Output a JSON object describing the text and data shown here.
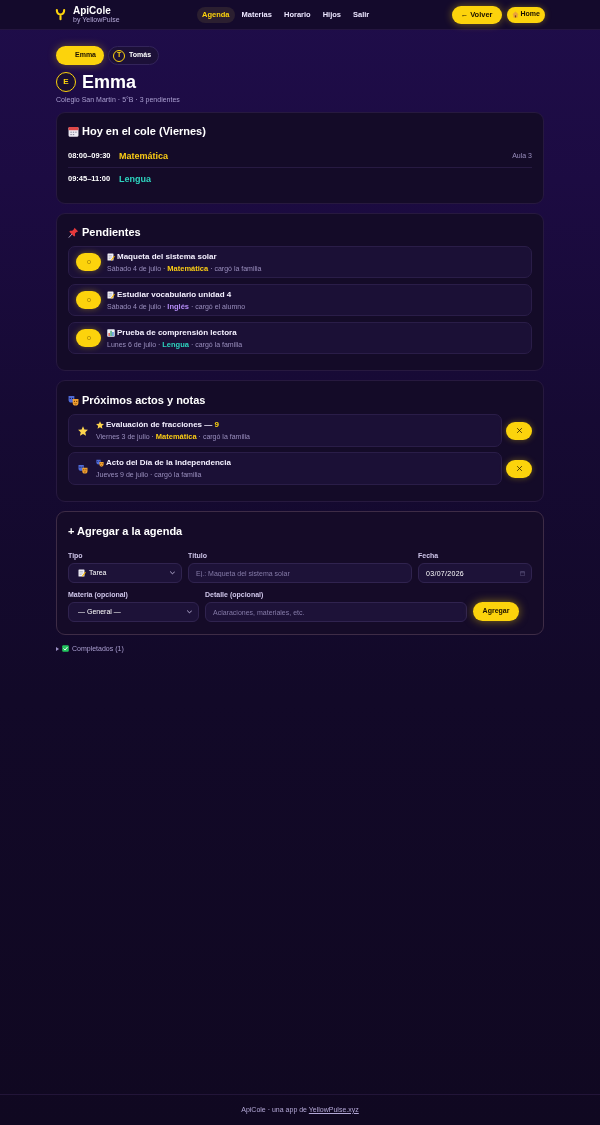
{
  "app": {
    "name": "ApiCole",
    "tagline": "by YellowPulse"
  },
  "nav": [
    {
      "label": "Agenda",
      "selected": true
    },
    {
      "label": "Materias",
      "selected": false
    },
    {
      "label": "Horario",
      "selected": false
    },
    {
      "label": "Hijos",
      "selected": false
    },
    {
      "label": "Salir",
      "selected": false
    }
  ],
  "header_buttons": [
    {
      "kind": "back",
      "label": "← Volver"
    },
    {
      "kind": "home",
      "label": "Home"
    }
  ],
  "children_tabs": [
    {
      "label": "Emma",
      "selected": true
    },
    {
      "label": "Tomás",
      "initial": "T",
      "selected": false
    }
  ],
  "profile": {
    "initial": "E",
    "name": "Emma",
    "subtitle": "Colegio San Martín · 5°B · 3 pendientes"
  },
  "today": {
    "title": "Hoy en el cole (Viernes)",
    "rows": [
      {
        "time": "08:00–09:30",
        "subject": "Matemática",
        "color": "#facc15",
        "room": "Aula 3"
      },
      {
        "time": "09:45–11:00",
        "subject": "Lengua",
        "color": "#2dd4bf"
      }
    ]
  },
  "pending": {
    "title": "Pendientes",
    "items": [
      {
        "kind": "tarea",
        "done": false,
        "title": "Maqueta del sistema solar",
        "date": "Sábado 4 de julio ·",
        "subject": "Matemática",
        "color": "#facc15",
        "source": "· cargó la familia"
      },
      {
        "kind": "tarea",
        "done": false,
        "title": "Estudiar vocabulario unidad 4",
        "date": "Sábado 4 de julio ·",
        "subject": "Inglés",
        "color": "#b48cf5",
        "source": "· cargó el alumno"
      },
      {
        "kind": "prueba",
        "done": false,
        "title": "Prueba de comprensión lectora",
        "date": "Lunes 6 de julio ·",
        "subject": "Lengua",
        "color": "#2dd4bf",
        "source": "· cargó la familia"
      }
    ]
  },
  "upcoming": {
    "title": "Próximos actos y notas",
    "items": [
      {
        "kind": "nota",
        "title": "Evaluación de fracciones —",
        "grade": "9",
        "date": "Viernes 3 de julio ·",
        "subject": "Matemática",
        "color": "#facc15",
        "source": "· cargó la familia"
      },
      {
        "kind": "acto",
        "title": "Acto del Día de la Independencia",
        "date": "Jueves 9 de julio ·",
        "source": "cargó la familia"
      }
    ]
  },
  "form": {
    "title": "+ Agregar a la agenda",
    "rows": [
      {
        "fields": [
          {
            "kind": "select",
            "label": "Tipo",
            "value": {
              "kind": "tarea",
              "label": "Tarea"
            }
          },
          {
            "kind": "text",
            "label": "Título",
            "placeholder": "Ej.: Maqueta del sistema solar"
          },
          {
            "kind": "date",
            "label": "Fecha",
            "value": "03/07/2026"
          }
        ]
      },
      {
        "fields": [
          {
            "kind": "select",
            "label": "Materia (opcional)",
            "value": {
              "label": "— General —"
            }
          },
          {
            "kind": "text",
            "label": "Detalle (opcional)",
            "placeholder": "Aclaraciones, materiales, etc."
          }
        ]
      }
    ],
    "submit": "Agregar"
  },
  "completed": {
    "label": "Completados (1)",
    "expanded": false
  },
  "footer": {
    "text": "ApiCole · una app de",
    "link": "YellowPulse.xyz"
  }
}
